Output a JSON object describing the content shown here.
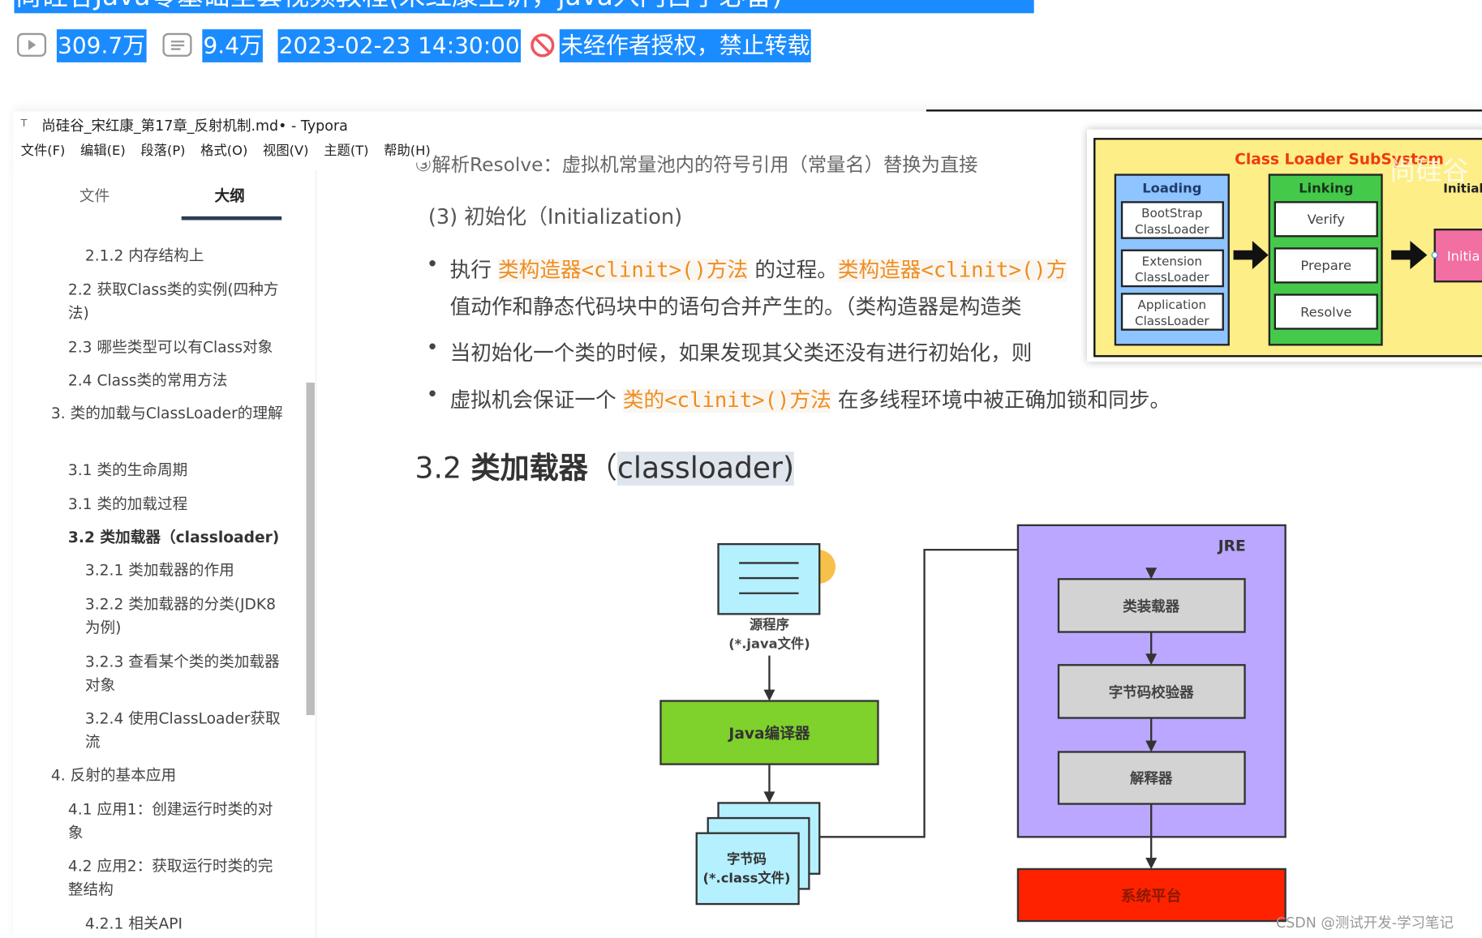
{
  "video": {
    "title": "尚硅谷Java零基础全套视频教程(宋红康主讲，java入门自学必备)",
    "views": "309.7万",
    "danmaku": "9.4万",
    "datetime": "2023-02-23 14:30:00",
    "copyright": "未经作者授权，禁止转载",
    "highlight_color": "#1a8cff"
  },
  "window": {
    "title": "尚硅谷_宋红康_第17章_反射机制.md• - Typora",
    "menu": [
      "文件(F)",
      "编辑(E)",
      "段落(P)",
      "格式(O)",
      "视图(V)",
      "主题(T)",
      "帮助(H)"
    ]
  },
  "sidebar": {
    "tabs": [
      "文件",
      "大纲"
    ],
    "active_tab": "大纲",
    "items": [
      "2.1.2 内存结构上",
      "2.2 获取Class类的实例(四种方法)",
      "2.3 哪些类型可以有Class对象",
      "2.4 Class类的常用方法",
      "3. 类的加载与ClassLoader的理解",
      "3.1 类的生命周期",
      "3.1 类的加载过程",
      "3.2 类加载器（classloader)",
      "3.2.1 类加载器的作用",
      "3.2.2 类加载器的分类(JDK8为例)",
      "3.2.3 查看某个类的类加载器对象",
      "3.2.4 使用ClassLoader获取流",
      "4. 反射的基本应用",
      "4.1 应用1：创建运行时类的对象",
      "4.2 应用2：获取运行时类的完整结构",
      "4.2.1 相关API"
    ],
    "active_item": "3.2 类加载器（classloader)"
  },
  "content": {
    "clipped_line": "③解析Resolve：虚拟机常量池内的符号引用（常量名）替换为直接",
    "subheading": "(3) 初始化（Initialization)",
    "bullet1": {
      "t1": "执行 ",
      "code1": "类构造器<clinit>()方法",
      "t2": " 的过程。",
      "code2": "类构造器<clinit>()方",
      "line2": "值动作和静态代码块中的语句合并产生的。（类构造器是构造类"
    },
    "bullet2": "当初始化一个类的时候，如果发现其父类还没有进行初始化，则",
    "bullet3": {
      "t1": "虚拟机会保证一个 ",
      "code": "类的<clinit>()方法",
      "t2": " 在多线程环境中被正确加锁和同步。"
    },
    "heading": {
      "num": "3.2 ",
      "zh": "类加载器",
      "open": "（",
      "sel": "classloader)"
    },
    "cursor_glyph": "I"
  },
  "subsystem_diagram": {
    "title": "Class Loader SubSystem",
    "watermark": "尚硅谷",
    "loading": {
      "label": "Loading",
      "items": [
        [
          "BootStrap",
          "ClassLoader"
        ],
        [
          "Extension",
          "ClassLoader"
        ],
        [
          "Application",
          "ClassLoader"
        ]
      ]
    },
    "linking": {
      "label": "Linking",
      "items": [
        "Verify",
        "Prepare",
        "Resolve"
      ]
    },
    "init_label": "Initial",
    "init_box": "Initia"
  },
  "jvm_diagram": {
    "source": [
      "源程序",
      "(*.java文件)"
    ],
    "compiler": "Java编译器",
    "bytecode": [
      "字节码",
      "(*.class文件)"
    ],
    "jre_label": "JRE",
    "jre_steps": [
      "类装载器",
      "字节码校验器",
      "解释器"
    ],
    "platform": "系统平台"
  },
  "watermark": "CSDN @测试开发-学习笔记"
}
